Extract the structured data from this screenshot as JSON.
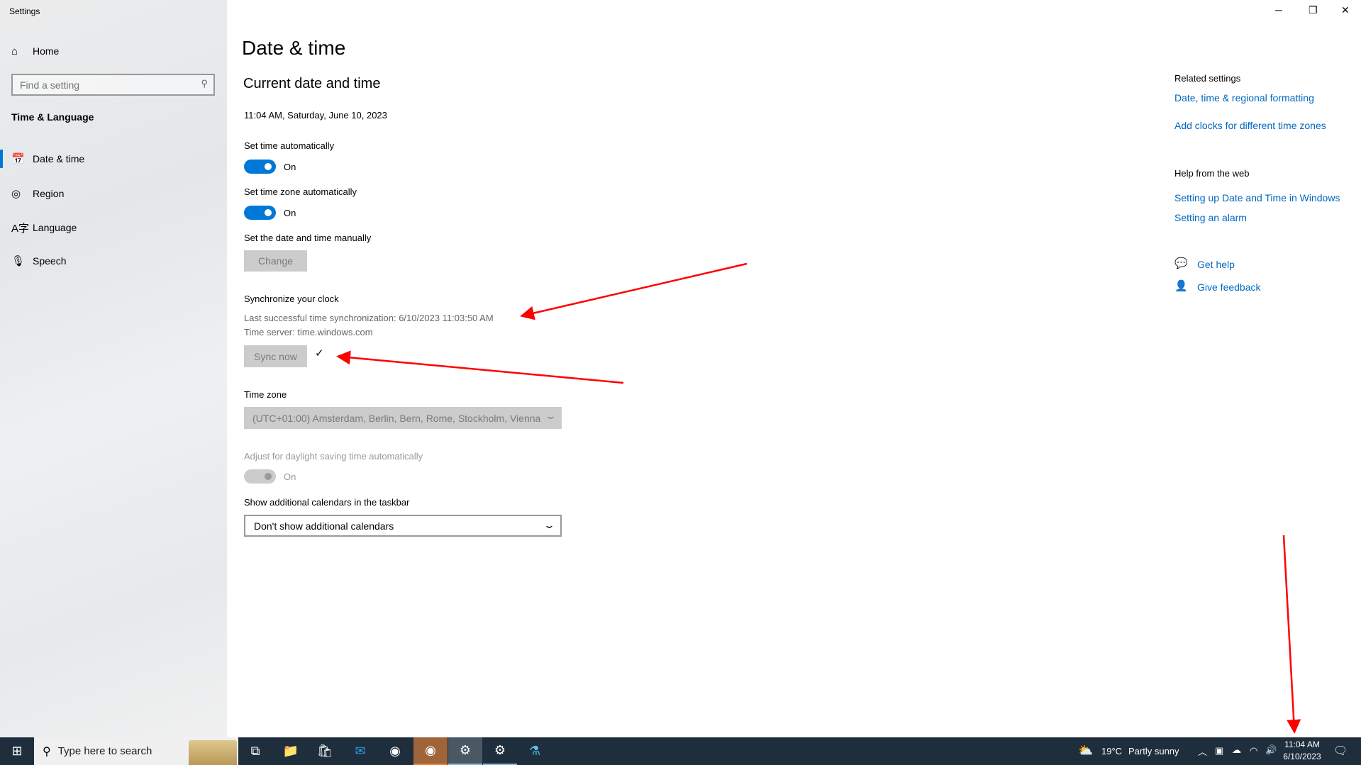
{
  "window": {
    "title": "Settings",
    "minimize": "─",
    "restore": "❐",
    "close": "✕"
  },
  "sidebar": {
    "home": "Home",
    "search_placeholder": "Find a setting",
    "section": "Time & Language",
    "items": [
      {
        "label": "Date & time",
        "active": true
      },
      {
        "label": "Region"
      },
      {
        "label": "Language"
      },
      {
        "label": "Speech"
      }
    ]
  },
  "main": {
    "title": "Date & time",
    "section_title": "Current date and time",
    "current_datetime": "11:04 AM, Saturday, June 10, 2023",
    "set_time_auto": {
      "label": "Set time automatically",
      "state": "On"
    },
    "set_tz_auto": {
      "label": "Set time zone automatically",
      "state": "On"
    },
    "manual": {
      "label": "Set the date and time manually",
      "button": "Change"
    },
    "sync": {
      "heading": "Synchronize your clock",
      "last": "Last successful time synchronization: 6/10/2023 11:03:50 AM",
      "server": "Time server: time.windows.com",
      "button": "Sync now",
      "check": "✓"
    },
    "timezone": {
      "label": "Time zone",
      "value": "(UTC+01:00) Amsterdam, Berlin, Bern, Rome, Stockholm, Vienna"
    },
    "dst": {
      "label": "Adjust for daylight saving time automatically",
      "state": "On"
    },
    "calendars": {
      "label": "Show additional calendars in the taskbar",
      "value": "Don't show additional calendars"
    }
  },
  "related": {
    "heading": "Related settings",
    "links": [
      "Date, time & regional formatting",
      "Add clocks for different time zones"
    ],
    "help_heading": "Help from the web",
    "help_links": [
      "Setting up Date and Time in Windows",
      "Setting an alarm"
    ],
    "get_help": "Get help",
    "feedback": "Give feedback"
  },
  "taskbar": {
    "search_placeholder": "Type here to search",
    "weather_temp": "19°C",
    "weather_text": "Partly sunny",
    "time": "11:04 AM",
    "date": "6/10/2023"
  },
  "colors": {
    "accent": "#0078d7",
    "annotation": "#ff0000",
    "taskbar": "#1f2e3c"
  }
}
